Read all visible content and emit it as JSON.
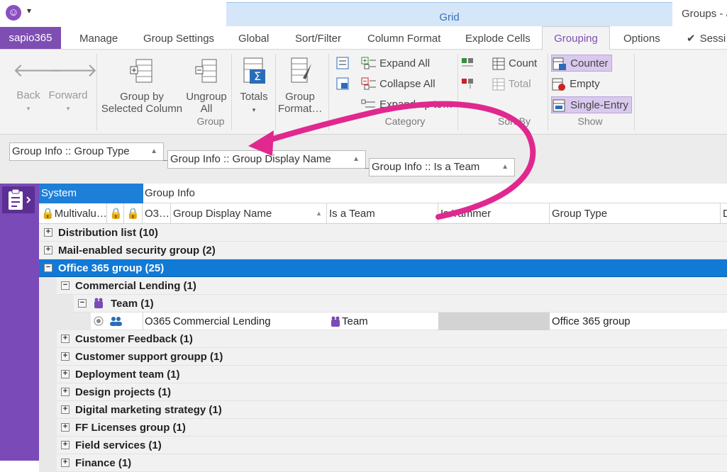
{
  "titlebar": {
    "context_tab": "Grid",
    "window_title": "Groups - a",
    "qat_arrow": "▾"
  },
  "file_tab": "sapio365",
  "tabs": [
    "Manage",
    "Group Settings",
    "Global",
    "Sort/Filter",
    "Column Format",
    "Explode Cells",
    "Grouping",
    "Options",
    "Sessi"
  ],
  "active_tab": "Grouping",
  "ribbon": {
    "back": "Back",
    "forward": "Forward",
    "group_by_selected_l1": "Group by",
    "group_by_selected_l2": "Selected Column",
    "ungroup_l1": "Ungroup",
    "ungroup_l2": "All",
    "totals": "Totals",
    "group_format_l1": "Group",
    "group_format_l2": "Format…",
    "group_label": "Group",
    "expand_all": "Expand All",
    "collapse_all": "Collapse All",
    "expand_up_to": "Expand up to…",
    "category_label": "Category",
    "count": "Count",
    "total": "Total",
    "sort_by_label": "Sort By",
    "counter": "Counter",
    "empty": "Empty",
    "single_entry": "Single-Entry",
    "show_label": "Show"
  },
  "group_chips": [
    "Group Info :: Group Type",
    "Group Info :: Group Display Name",
    "Group Info :: Is a Team"
  ],
  "header": {
    "system_band": "System",
    "group_info_band": "Group Info",
    "columns": [
      "Multivalu…",
      "O3…",
      "Group Display Name",
      "Is a Team",
      "Is Yammer",
      "Group Type",
      "D"
    ]
  },
  "rows": [
    {
      "label": "Distribution list (10)"
    },
    {
      "label": "Mail-enabled security group (2)"
    },
    {
      "label": "Office 365 group (25)"
    },
    {
      "label": "Commercial Lending (1)"
    },
    {
      "label": "Team (1)"
    },
    {
      "label": "Customer Feedback (1)"
    },
    {
      "label": "Customer support groupp (1)"
    },
    {
      "label": "Deployment team (1)"
    },
    {
      "label": "Design projects (1)"
    },
    {
      "label": "Digital marketing strategy (1)"
    },
    {
      "label": "FF Licenses group (1)"
    },
    {
      "label": "Field services (1)"
    },
    {
      "label": "Finance (1)"
    }
  ],
  "data_row": {
    "o365": "O365",
    "display_name": "Commercial Lending",
    "is_team": "Team",
    "group_type": "Office 365 group"
  },
  "colors": {
    "accent": "#7e4eb3",
    "selection": "#1179d6",
    "arrow": "#e0288f"
  }
}
